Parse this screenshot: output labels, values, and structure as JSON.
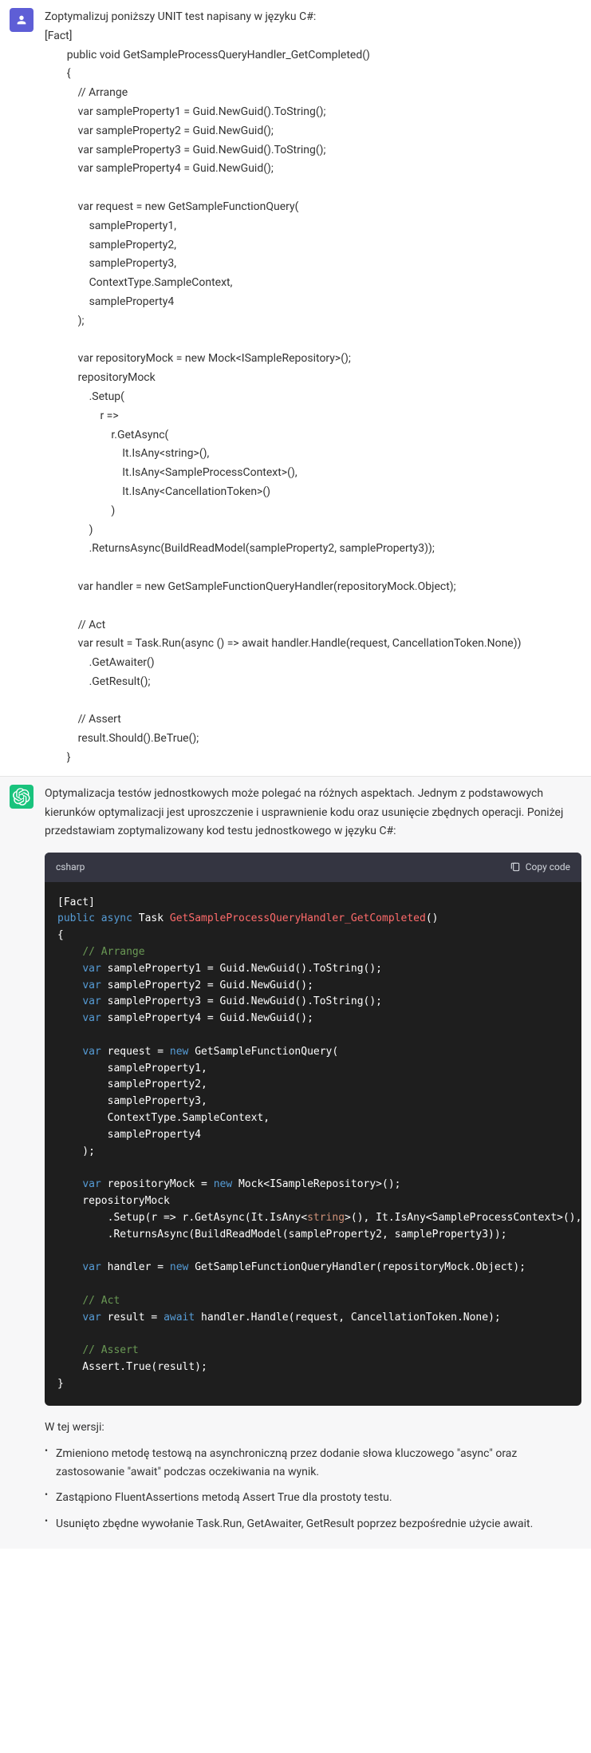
{
  "user_message": {
    "intro": "Zoptymalizuj poniższy UNIT test napisany w języku C#:",
    "code": "[Fact]\n        public void GetSampleProcessQueryHandler_GetCompleted()\n        {\n            // Arrange\n            var sampleProperty1 = Guid.NewGuid().ToString();\n            var sampleProperty2 = Guid.NewGuid();\n            var sampleProperty3 = Guid.NewGuid().ToString();\n            var sampleProperty4 = Guid.NewGuid();\n\n            var request = new GetSampleFunctionQuery(\n                sampleProperty1,\n                sampleProperty2,\n                sampleProperty3,\n                ContextType.SampleContext,\n                sampleProperty4\n            );\n\n            var repositoryMock = new Mock<ISampleRepository>();\n            repositoryMock\n                .Setup(\n                    r =>\n                        r.GetAsync(\n                            It.IsAny<string>(),\n                            It.IsAny<SampleProcessContext>(),\n                            It.IsAny<CancellationToken>()\n                        )\n                )\n                .ReturnsAsync(BuildReadModel(sampleProperty2, sampleProperty3));\n\n            var handler = new GetSampleFunctionQueryHandler(repositoryMock.Object);\n\n            // Act\n            var result = Task.Run(async () => await handler.Handle(request, CancellationToken.None))\n                .GetAwaiter()\n                .GetResult();\n\n            // Assert\n            result.Should().BeTrue();\n        }"
  },
  "assistant_message": {
    "intro": "Optymalizacja testów jednostkowych może polegać na różnych aspektach. Jednym z podstawowych kierunków optymalizacji jest uproszczenie i usprawnienie kodu oraz usunięcie zbędnych operacji. Poniżej przedstawiam zoptymalizowany kod testu jednostkowego w języku C#:",
    "code_lang": "csharp",
    "copy_label": "Copy code",
    "code_tokens": [
      [
        [
          "punc",
          "["
        ],
        [
          "type",
          "Fact"
        ],
        [
          "punc",
          "]"
        ]
      ],
      [
        [
          "keyword",
          "public"
        ],
        [
          "punc",
          " "
        ],
        [
          "keyword",
          "async"
        ],
        [
          "punc",
          " "
        ],
        [
          "type",
          "Task"
        ],
        [
          "punc",
          " "
        ],
        [
          "method",
          "GetSampleProcessQueryHandler_GetCompleted"
        ],
        [
          "punc",
          "()"
        ]
      ],
      [
        [
          "punc",
          "{"
        ]
      ],
      [
        [
          "punc",
          "    "
        ],
        [
          "comment",
          "// Arrange"
        ]
      ],
      [
        [
          "punc",
          "    "
        ],
        [
          "keyword",
          "var"
        ],
        [
          "punc",
          " sampleProperty1 = Guid.NewGuid().ToString();"
        ]
      ],
      [
        [
          "punc",
          "    "
        ],
        [
          "keyword",
          "var"
        ],
        [
          "punc",
          " sampleProperty2 = Guid.NewGuid();"
        ]
      ],
      [
        [
          "punc",
          "    "
        ],
        [
          "keyword",
          "var"
        ],
        [
          "punc",
          " sampleProperty3 = Guid.NewGuid().ToString();"
        ]
      ],
      [
        [
          "punc",
          "    "
        ],
        [
          "keyword",
          "var"
        ],
        [
          "punc",
          " sampleProperty4 = Guid.NewGuid();"
        ]
      ],
      [
        [
          "punc",
          ""
        ]
      ],
      [
        [
          "punc",
          "    "
        ],
        [
          "keyword",
          "var"
        ],
        [
          "punc",
          " request = "
        ],
        [
          "keyword",
          "new"
        ],
        [
          "punc",
          " GetSampleFunctionQuery("
        ]
      ],
      [
        [
          "punc",
          "        sampleProperty1,"
        ]
      ],
      [
        [
          "punc",
          "        sampleProperty2,"
        ]
      ],
      [
        [
          "punc",
          "        sampleProperty3,"
        ]
      ],
      [
        [
          "punc",
          "        ContextType.SampleContext,"
        ]
      ],
      [
        [
          "punc",
          "        sampleProperty4"
        ]
      ],
      [
        [
          "punc",
          "    );"
        ]
      ],
      [
        [
          "punc",
          ""
        ]
      ],
      [
        [
          "punc",
          "    "
        ],
        [
          "keyword",
          "var"
        ],
        [
          "punc",
          " repositoryMock = "
        ],
        [
          "keyword",
          "new"
        ],
        [
          "punc",
          " Mock<ISampleRepository>();"
        ]
      ],
      [
        [
          "punc",
          "    repositoryMock"
        ]
      ],
      [
        [
          "punc",
          "        .Setup(r => r.GetAsync(It.IsAny<"
        ],
        [
          "gen",
          "string"
        ],
        [
          "punc",
          ">(), It.IsAny<SampleProcessContext>(), It.IsAny<CancellationToken>()))"
        ]
      ],
      [
        [
          "punc",
          "        .ReturnsAsync(BuildReadModel(sampleProperty2, sampleProperty3));"
        ]
      ],
      [
        [
          "punc",
          ""
        ]
      ],
      [
        [
          "punc",
          "    "
        ],
        [
          "keyword",
          "var"
        ],
        [
          "punc",
          " handler = "
        ],
        [
          "keyword",
          "new"
        ],
        [
          "punc",
          " GetSampleFunctionQueryHandler(repositoryMock.Object);"
        ]
      ],
      [
        [
          "punc",
          ""
        ]
      ],
      [
        [
          "punc",
          "    "
        ],
        [
          "comment",
          "// Act"
        ]
      ],
      [
        [
          "punc",
          "    "
        ],
        [
          "keyword",
          "var"
        ],
        [
          "punc",
          " result = "
        ],
        [
          "keyword",
          "await"
        ],
        [
          "punc",
          " handler.Handle(request, CancellationToken.None);"
        ]
      ],
      [
        [
          "punc",
          ""
        ]
      ],
      [
        [
          "punc",
          "    "
        ],
        [
          "comment",
          "// Assert"
        ]
      ],
      [
        [
          "punc",
          "    Assert.True(result);"
        ]
      ],
      [
        [
          "punc",
          "}"
        ]
      ]
    ],
    "summary_intro": "W tej wersji:",
    "bullets": [
      "Zmieniono metodę testową na asynchroniczną przez dodanie słowa kluczowego \"async\" oraz zastosowanie \"await\" podczas oczekiwania na wynik.",
      "Zastąpiono FluentAssertions metodą Assert True dla prostoty testu.",
      "Usunięto zbędne wywołanie Task.Run, GetAwaiter, GetResult poprzez bezpośrednie użycie await."
    ]
  }
}
